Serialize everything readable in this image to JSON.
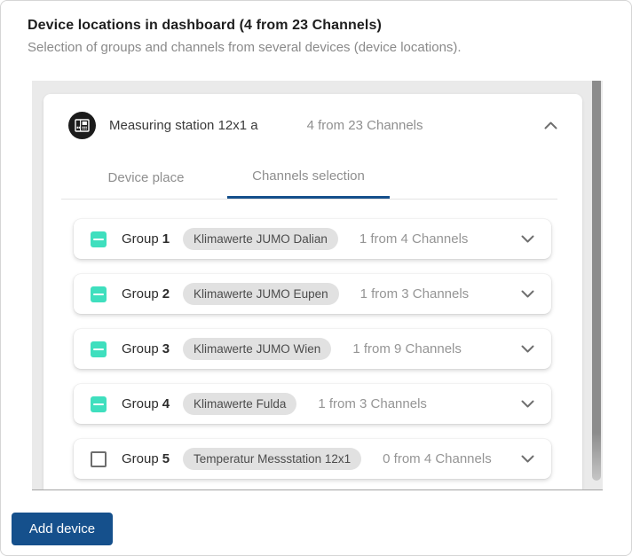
{
  "header": {
    "title": "Device locations in dashboard (4 from 23 Channels)",
    "subtitle": "Selection of groups and channels from several devices (device locations)."
  },
  "device": {
    "name": "Measuring station 12x1 a",
    "count": "4 from 23 Channels",
    "collapse_state": "expanded"
  },
  "tabs": [
    {
      "label": "Device place",
      "active": false
    },
    {
      "label": "Channels selection",
      "active": true
    }
  ],
  "groups": [
    {
      "label": "Group",
      "number": "1",
      "badge": "Klimawerte JUMO Dalian",
      "count": "1 from 4 Channels",
      "checkbox": "indeterminate"
    },
    {
      "label": "Group",
      "number": "2",
      "badge": "Klimawerte JUMO Eupen",
      "count": "1 from 3 Channels",
      "checkbox": "indeterminate"
    },
    {
      "label": "Group",
      "number": "3",
      "badge": "Klimawerte JUMO Wien",
      "count": "1 from 9 Channels",
      "checkbox": "indeterminate"
    },
    {
      "label": "Group",
      "number": "4",
      "badge": "Klimawerte Fulda",
      "count": "1 from 3 Channels",
      "checkbox": "indeterminate"
    },
    {
      "label": "Group",
      "number": "5",
      "badge": "Temperatur Messstation 12x1",
      "count": "0 from 4 Channels",
      "checkbox": "unchecked"
    }
  ],
  "footer": {
    "add_device_label": "Add device"
  },
  "colors": {
    "accent_blue": "#15508c",
    "checkbox_teal": "#3fdfbe",
    "badge_bg": "#e1e1e1",
    "panel_bg": "#eaeaea"
  }
}
